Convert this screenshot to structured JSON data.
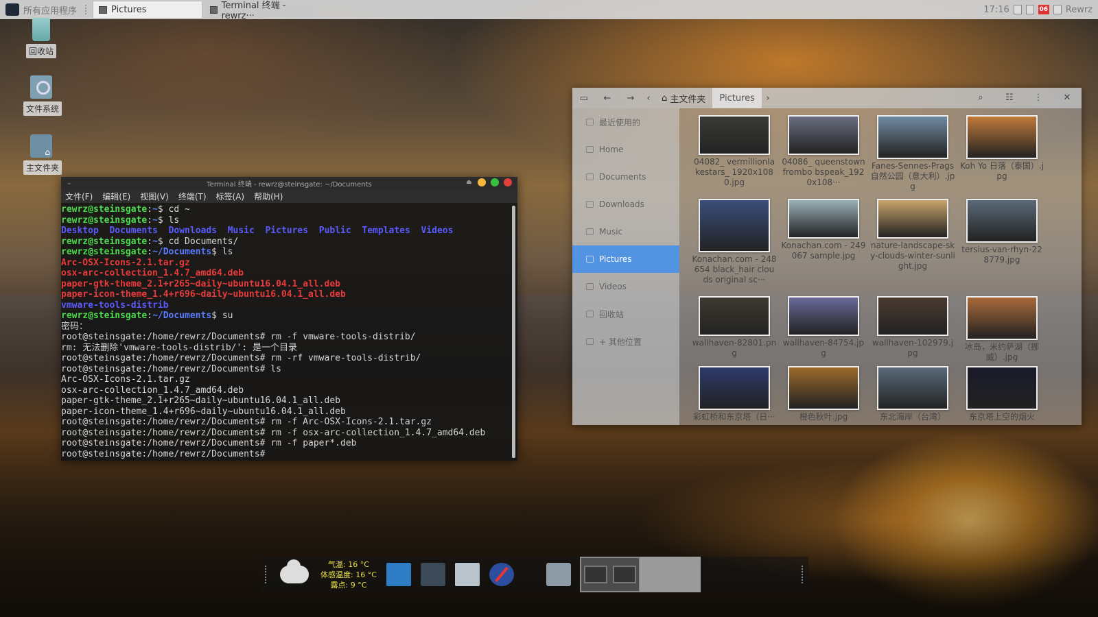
{
  "top_panel": {
    "app_menu_label": "所有应用程序",
    "tasks": [
      {
        "label": "Pictures"
      },
      {
        "label": "Terminal 终端 - rewrz···"
      }
    ],
    "clock": "17:16",
    "calendar_day": "06",
    "user": "Rewrz"
  },
  "desktop": {
    "icons": [
      {
        "label": "回收站",
        "icon": "trash-icon"
      },
      {
        "label": "文件系统",
        "icon": "filesystem-icon"
      },
      {
        "label": "主文件夹",
        "icon": "home-folder-icon"
      }
    ]
  },
  "terminal": {
    "title": "Terminal 终端 - rewrz@steinsgate: ~/Documents",
    "menu": [
      "文件(F)",
      "编辑(E)",
      "视图(V)",
      "终端(T)",
      "标签(A)",
      "帮助(H)"
    ],
    "lines": [
      {
        "prompt_user": "rewrz@steinsgate",
        "prompt_path": "~",
        "cmd": "cd ~"
      },
      {
        "prompt_user": "rewrz@steinsgate",
        "prompt_path": "~",
        "cmd": "ls"
      },
      {
        "dirs": [
          "Desktop",
          "Documents",
          "Downloads",
          "Music",
          "Pictures",
          "Public",
          "Templates",
          "Videos"
        ]
      },
      {
        "prompt_user": "rewrz@steinsgate",
        "prompt_path": "~",
        "cmd": "cd Documents/"
      },
      {
        "prompt_user": "rewrz@steinsgate",
        "prompt_path": "~/Documents",
        "cmd": "ls"
      },
      {
        "red": "Arc-OSX-Icons-2.1.tar.gz"
      },
      {
        "red": "osx-arc-collection_1.4.7_amd64.deb"
      },
      {
        "red": "paper-gtk-theme_2.1+r265~daily~ubuntu16.04.1_all.deb"
      },
      {
        "red": "paper-icon-theme_1.4+r696~daily~ubuntu16.04.1_all.deb"
      },
      {
        "dir": "vmware-tools-distrib"
      },
      {
        "prompt_user": "rewrz@steinsgate",
        "prompt_path": "~/Documents",
        "cmd": "su"
      },
      {
        "text": "密码："
      },
      {
        "text": "root@steinsgate:/home/rewrz/Documents# rm -f vmware-tools-distrib/"
      },
      {
        "text": "rm: 无法删除'vmware-tools-distrib/': 是一个目录"
      },
      {
        "text": "root@steinsgate:/home/rewrz/Documents# rm -rf vmware-tools-distrib/"
      },
      {
        "text": "root@steinsgate:/home/rewrz/Documents# ls"
      },
      {
        "text": "Arc-OSX-Icons-2.1.tar.gz"
      },
      {
        "text": "osx-arc-collection_1.4.7_amd64.deb"
      },
      {
        "text": "paper-gtk-theme_2.1+r265~daily~ubuntu16.04.1_all.deb"
      },
      {
        "text": "paper-icon-theme_1.4+r696~daily~ubuntu16.04.1_all.deb"
      },
      {
        "text": "root@steinsgate:/home/rewrz/Documents# rm -f Arc-OSX-Icons-2.1.tar.gz"
      },
      {
        "text": "root@steinsgate:/home/rewrz/Documents# rm -f osx-arc-collection_1.4.7_amd64.deb"
      },
      {
        "text": "root@steinsgate:/home/rewrz/Documents# rm -f paper*.deb"
      },
      {
        "text": "root@steinsgate:/home/rewrz/Documents# "
      }
    ]
  },
  "file_manager": {
    "breadcrumb": [
      "主文件夹",
      "Pictures"
    ],
    "sidebar": [
      {
        "label": "最近使用的",
        "active": false
      },
      {
        "label": "Home",
        "active": false
      },
      {
        "label": "Documents",
        "active": false
      },
      {
        "label": "Downloads",
        "active": false
      },
      {
        "label": "Music",
        "active": false
      },
      {
        "label": "Pictures",
        "active": true
      },
      {
        "label": "Videos",
        "active": false
      },
      {
        "label": "回收站",
        "active": false
      },
      {
        "label": "+ 其他位置",
        "active": false
      }
    ],
    "files": [
      {
        "name": "04082_ vermillionlakestars_ 1920x1080.jpg",
        "color": "#3b3a36"
      },
      {
        "name": "04086_ queenstownfrombo bspeak_1920x108···",
        "color": "#6a6e80"
      },
      {
        "name": "Fanes-Sennes-Prags 自然公园（意大利）.jpg",
        "color": "#6f8aa0"
      },
      {
        "name": "Koh Yo 日落（泰国）.jpg",
        "color": "#c07a3a"
      },
      {
        "name": "Konachan.com - 248654 black_hair clouds original sc···",
        "color": "#3a4e7a"
      },
      {
        "name": "Konachan.com - 249067 sample.jpg",
        "color": "#9ab0b8"
      },
      {
        "name": "nature-landscape-sky-clouds-winter-sunlight.jpg",
        "color": "#c8a46a"
      },
      {
        "name": "tersius-van-rhyn-228779.jpg",
        "color": "#5a6a78"
      },
      {
        "name": "wallhaven-82801.png",
        "color": "#3e3a30"
      },
      {
        "name": "wallhaven-84754.jpg",
        "color": "#6a6a9a"
      },
      {
        "name": "wallhaven-102979.jpg",
        "color": "#4a3a30"
      },
      {
        "name": "冰岛，米约萨湖（挪威）.jpg",
        "color": "#a86a3a"
      },
      {
        "name": "彩虹桥和东京塔（日···",
        "color": "#2e3a6a"
      },
      {
        "name": "橙色秋叶.jpg",
        "color": "#9a6a2a"
      },
      {
        "name": "东北海岸（台湾）",
        "color": "#5a6a7a"
      },
      {
        "name": "东京塔上空的烟火",
        "color": "#1a1a2a"
      }
    ]
  },
  "dock": {
    "weather": [
      "气温: 16 °C",
      "体感温度: 16 °C",
      "露点: 9 °C"
    ],
    "apps": [
      {
        "icon": "files-icon"
      },
      {
        "icon": "terminal-icon"
      },
      {
        "icon": "folder-icon"
      },
      {
        "icon": "browser-compass-icon"
      },
      {
        "icon": "folder-icon"
      }
    ]
  },
  "colors": {
    "accent": "#5294e2",
    "prompt_user": "#4ddc4d",
    "prompt_path": "#5a7cff",
    "archive_red": "#e83a3a"
  }
}
